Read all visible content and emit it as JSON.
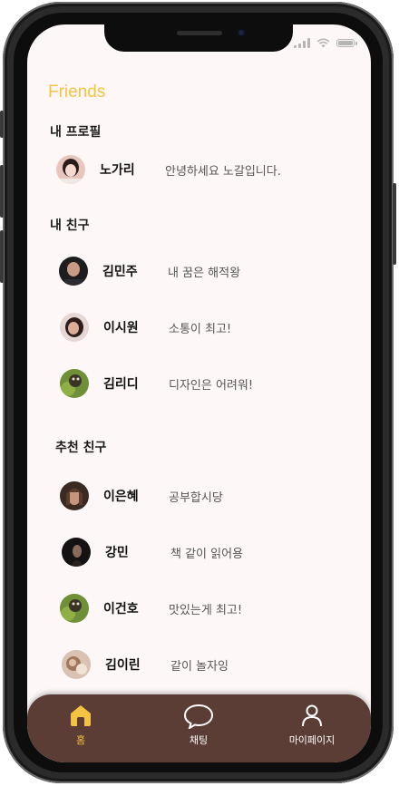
{
  "app": {
    "title": "Friends"
  },
  "sections": {
    "my_profile": "내 프로필",
    "my_friends": "내 친구",
    "recommended": "추천 친구"
  },
  "profile": {
    "name": "노가리",
    "status": "안녕하세요 노갈입니다."
  },
  "friends": [
    {
      "name": "김민주",
      "status": "내 꿈은 해적왕"
    },
    {
      "name": "이시원",
      "status": "소통이 최고!"
    },
    {
      "name": "김리디",
      "status": "디자인은 어려워!"
    }
  ],
  "recommended": [
    {
      "name": "이은혜",
      "status": "공부합시당"
    },
    {
      "name": "강민",
      "status": "책 같이 읽어용"
    },
    {
      "name": "이건호",
      "status": "맛있는게 최고!"
    },
    {
      "name": "김이린",
      "status": "같이 놀자잉"
    }
  ],
  "tabs": [
    {
      "label": "홈",
      "icon": "home-icon",
      "active": true
    },
    {
      "label": "채팅",
      "icon": "chat-bubble-icon",
      "active": false
    },
    {
      "label": "마이페이지",
      "icon": "user-icon",
      "active": false
    }
  ],
  "colors": {
    "accent": "#f5c342",
    "screen_bg": "#fdf8f7",
    "tab_bar": "#5c3d35"
  }
}
